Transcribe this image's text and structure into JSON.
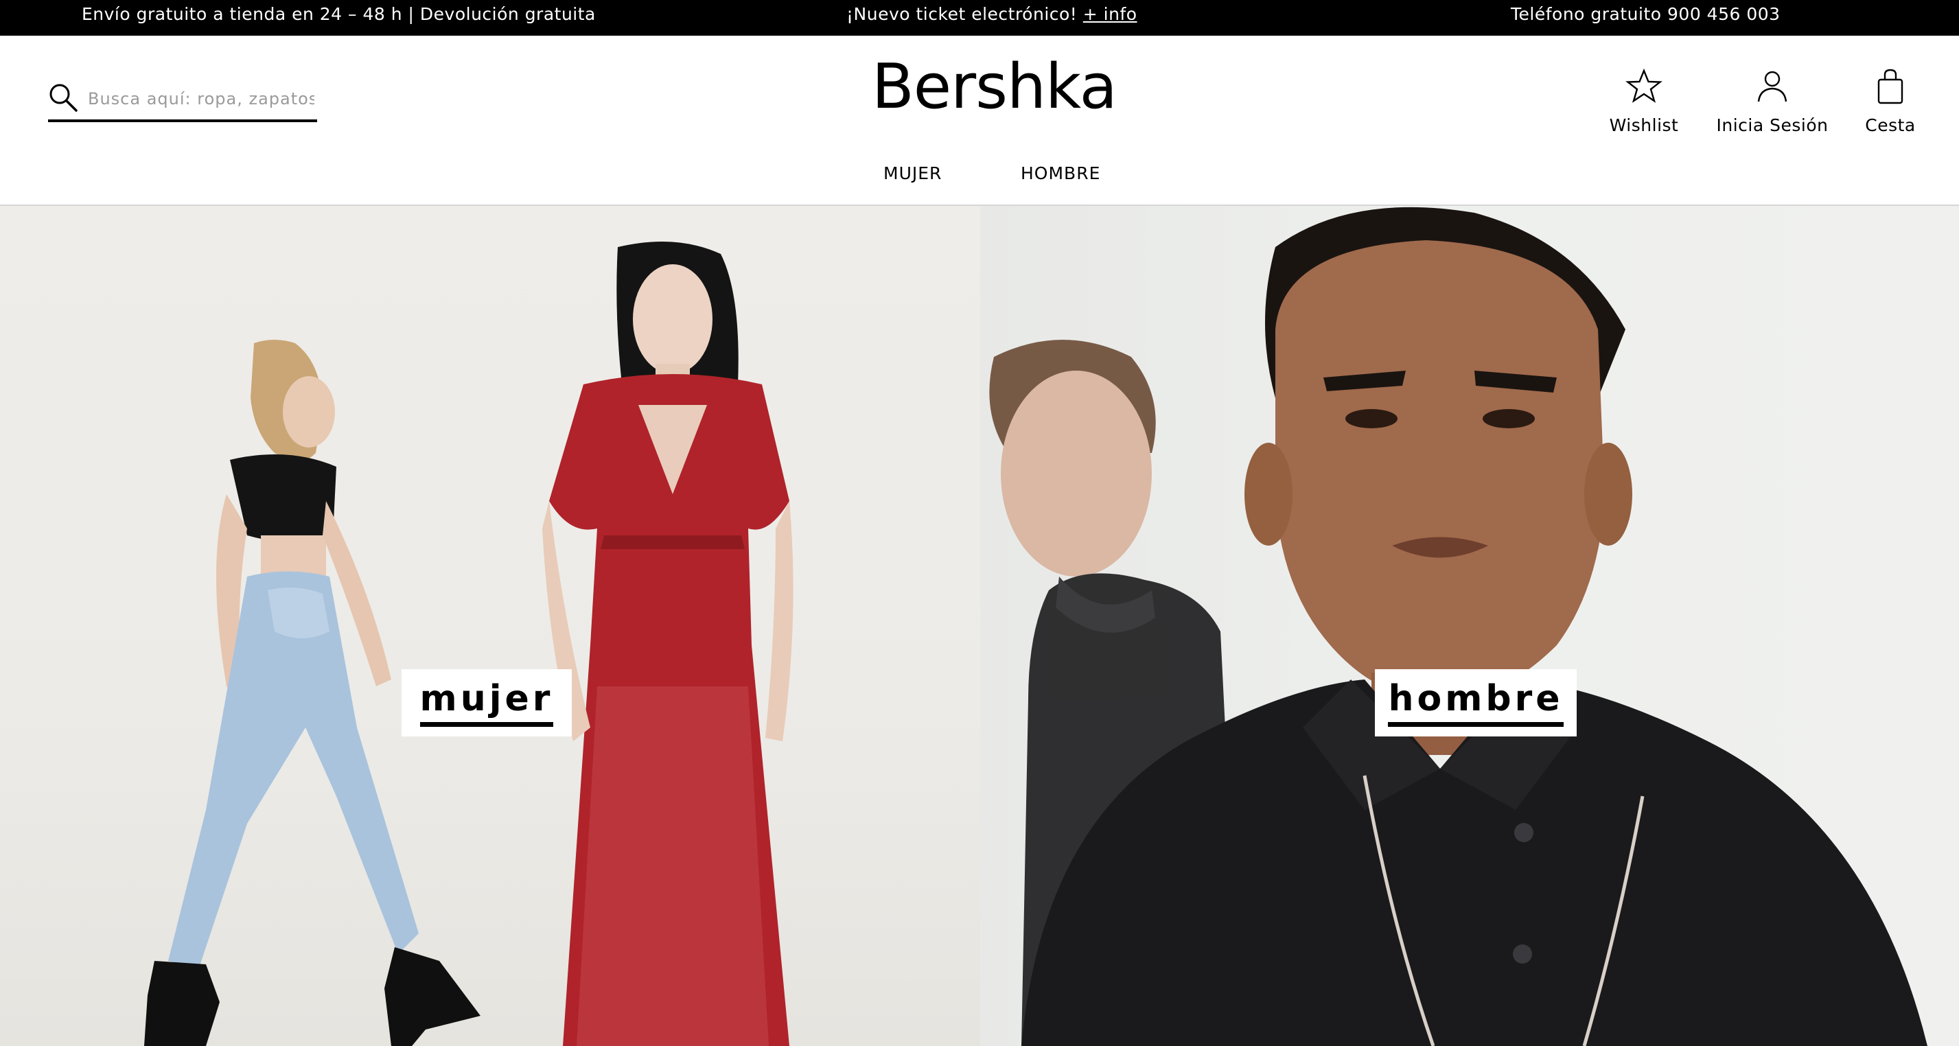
{
  "topbar": {
    "left_text": "Envío gratuito a tienda en 24 – 48 h | Devolución gratuita",
    "center_text": "¡Nuevo ticket electrónico!",
    "center_link": "+ info",
    "right_text": "Teléfono gratuito 900 456 003",
    "background": "#000000",
    "text_color": "#ffffff"
  },
  "header": {
    "search": {
      "icon": "search-icon",
      "placeholder": "Busca aquí: ropa, zapatos...",
      "value": ""
    },
    "logo": "Bershka",
    "icons": [
      {
        "icon": "star-icon",
        "label": "Wishlist"
      },
      {
        "icon": "user-icon",
        "label": "Inicia Sesión"
      },
      {
        "icon": "shopping-bag-icon",
        "label": "Cesta"
      }
    ],
    "nav": [
      {
        "label": "MUJER"
      },
      {
        "label": "HOMBRE"
      }
    ]
  },
  "hero": {
    "left": {
      "label": "mujer"
    },
    "right": {
      "label": "hombre"
    }
  }
}
